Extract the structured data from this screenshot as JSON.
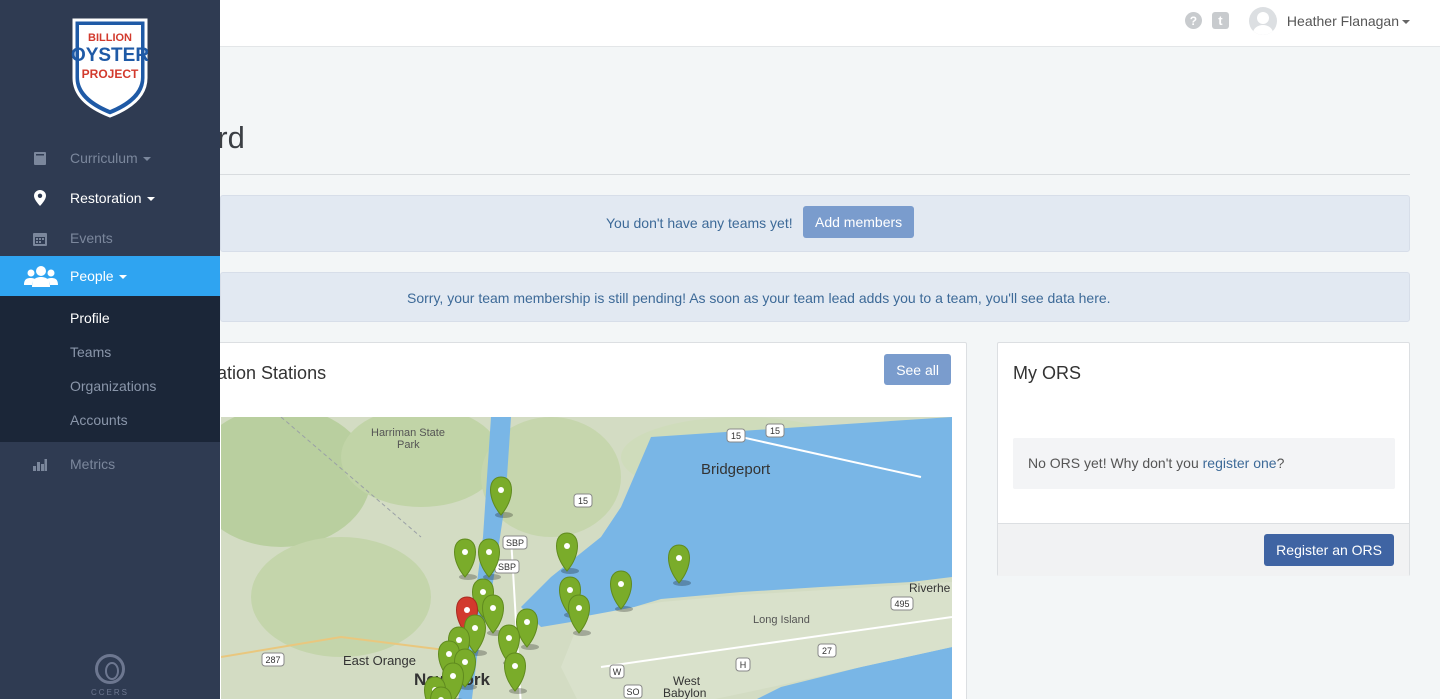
{
  "app": {
    "logo_lines": [
      "BILLION",
      "OYSTER",
      "PROJECT"
    ],
    "footer_logo_text": "CCERS"
  },
  "topbar": {
    "help_glyph": "?",
    "tumblr_glyph": "t",
    "user_name": "Heather Flanagan"
  },
  "sidebar": {
    "items": [
      {
        "label": "Curriculum",
        "icon": "book-icon"
      },
      {
        "label": "Restoration",
        "icon": "map-marker-icon"
      },
      {
        "label": "Events",
        "icon": "calendar-icon"
      },
      {
        "label": "People",
        "icon": "users-icon"
      },
      {
        "label": "Metrics",
        "icon": "bar-chart-icon"
      }
    ],
    "subitems": [
      {
        "label": "Profile"
      },
      {
        "label": "Teams"
      },
      {
        "label": "Organizations"
      },
      {
        "label": "Accounts"
      }
    ]
  },
  "main": {
    "title": "ard",
    "alert_teams": {
      "text": "You don't have any teams yet!",
      "button": "Add members"
    },
    "alert_pending": {
      "text": "Sorry, your team membership is still pending! As soon as your team lead adds you to a team, you'll see data here."
    },
    "stations_panel": {
      "title": "oration Stations",
      "button": "See all",
      "map_labels": [
        "Harriman State",
        "Park",
        "Bridgeport",
        "Long Island",
        "East Orange",
        "New York",
        "West",
        "Babylon",
        "Riverhe"
      ],
      "road_shields": [
        "15",
        "15",
        "15",
        "SBP",
        "SBP",
        "287",
        "495",
        "27",
        "W",
        "H",
        "SO"
      ]
    },
    "ors_panel": {
      "title": "My ORS",
      "empty_text_before": "No ORS yet! Why don't you ",
      "empty_link": "register one",
      "empty_text_after": "?",
      "button": "Register an ORS"
    }
  },
  "colors": {
    "sidebar_bg": "#2f3b52",
    "sidebar_active": "#2fa4f1",
    "subnav_bg": "#1b2638",
    "alert_bg": "#e2e9f2",
    "button_light": "#7a9ccd",
    "button_primary": "#3f64a3",
    "marker_green": "#7aac2a",
    "marker_red": "#d23a2d",
    "water": "#79b6e6"
  }
}
